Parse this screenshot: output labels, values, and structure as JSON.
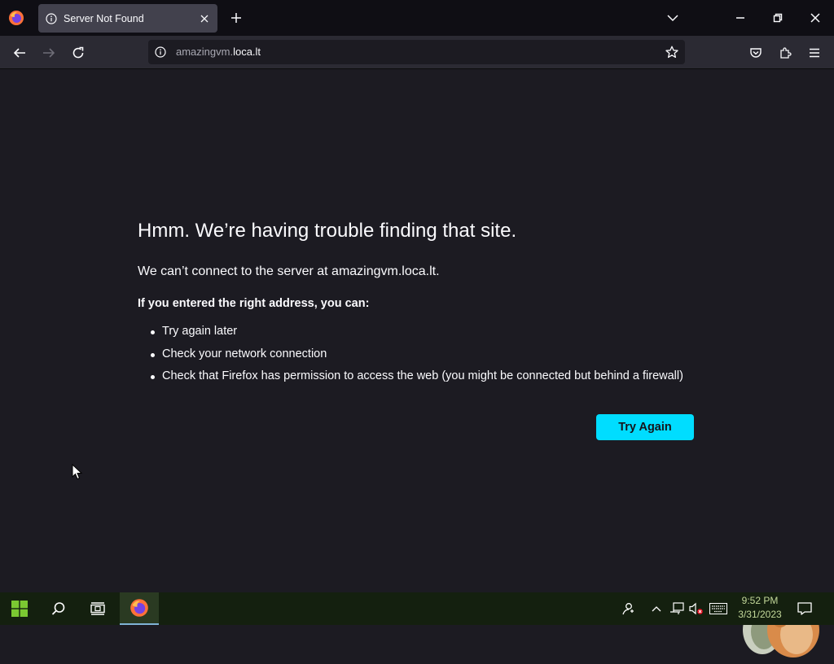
{
  "browser": {
    "tab": {
      "title": "Server Not Found"
    },
    "url": {
      "host_prefix": "amazingvm.",
      "host_main": "loca.lt"
    },
    "icons": [
      "firefox-icon",
      "info-icon",
      "close-icon",
      "plus-icon",
      "chevron-down-icon",
      "minimize-icon",
      "restore-icon",
      "back-icon",
      "forward-icon",
      "reload-icon",
      "star-icon",
      "pocket-icon",
      "extensions-icon",
      "menu-icon"
    ]
  },
  "error_page": {
    "title": "Hmm. We’re having trouble finding that site.",
    "description": "We can’t connect to the server at amazingvm.loca.lt.",
    "subtitle": "If you entered the right address, you can:",
    "suggestions": [
      "Try again later",
      "Check your network connection",
      "Check that Firefox has permission to access the web (you might be connected but behind a firewall)"
    ],
    "try_again_label": "Try Again",
    "accent_color": "#00ddff"
  },
  "taskbar": {
    "time": "9:52 PM",
    "date": "3/31/2023",
    "icons": [
      "windows-start-icon",
      "search-icon",
      "task-view-icon",
      "firefox-icon",
      "people-icon",
      "chevron-up-icon",
      "network-icon",
      "volume-muted-icon",
      "keyboard-icon",
      "notification-icon"
    ]
  }
}
